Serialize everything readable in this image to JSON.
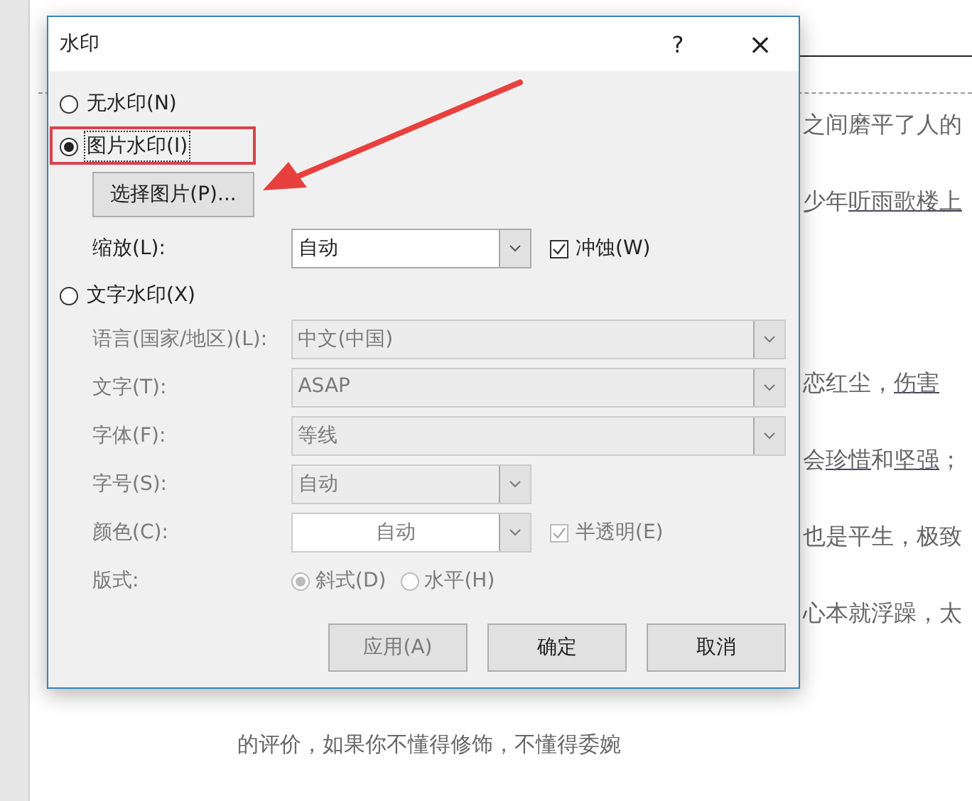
{
  "document": {
    "lines": [
      {
        "segments": [
          {
            "text": "之间磨平了人的",
            "link": false
          }
        ]
      },
      {
        "segments": [
          {
            "text": "少年",
            "link": false
          },
          {
            "text": "听雨歌楼上",
            "link": true
          }
        ]
      },
      {
        "segments": [
          {
            "text": "恋红尘，",
            "link": false
          },
          {
            "text": "伤害",
            "link": true
          }
        ]
      },
      {
        "segments": [
          {
            "text": "会",
            "link": false
          },
          {
            "text": "珍惜",
            "link": true
          },
          {
            "text": "和",
            "link": false
          },
          {
            "text": "坚强",
            "link": true
          },
          {
            "text": "；",
            "link": false
          }
        ]
      },
      {
        "segments": [
          {
            "text": "也是平生，极致",
            "link": false
          }
        ]
      },
      {
        "segments": [
          {
            "text": "心本就浮躁，太",
            "link": false
          }
        ]
      }
    ],
    "bottom_line": "的评价，如果你不懂得修饰，不懂得委婉"
  },
  "window": {
    "title": "水印",
    "help": "?",
    "close": "×"
  },
  "no_watermark": {
    "label": "无水印(N)",
    "selected": false
  },
  "picture_watermark": {
    "label": "图片水印(I)",
    "selected": true,
    "select_button": "选择图片(P)...",
    "scale": {
      "label": "缩放(L):",
      "value": "自动"
    },
    "washout": {
      "label": "冲蚀(W)",
      "checked": true
    }
  },
  "text_watermark": {
    "label": "文字水印(X)",
    "selected": false,
    "disabled": true,
    "rows": [
      {
        "kind": "wide",
        "label": "语言(国家/地区)(L):",
        "value": "中文(中国)"
      },
      {
        "kind": "wide",
        "label": "文字(T):",
        "value": "ASAP"
      },
      {
        "kind": "wide",
        "label": "字体(F):",
        "value": "等线"
      },
      {
        "kind": "narrow",
        "label": "字号(S):",
        "value": "自动"
      },
      {
        "kind": "color",
        "label": "颜色(C):",
        "value": "自动",
        "checkbox": {
          "label": "半透明(E)",
          "checked": true
        }
      },
      {
        "kind": "radios",
        "label": "版式:",
        "options": [
          {
            "label": "斜式(D)",
            "selected": true
          },
          {
            "label": "水平(H)",
            "selected": false
          }
        ]
      }
    ]
  },
  "buttons": [
    {
      "label": "应用(A)",
      "disabled": true
    },
    {
      "label": "确定",
      "disabled": false
    },
    {
      "label": "取消",
      "disabled": false
    }
  ]
}
